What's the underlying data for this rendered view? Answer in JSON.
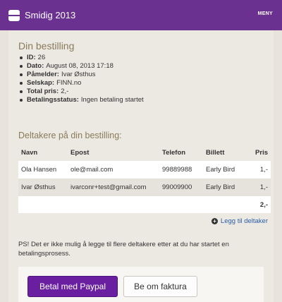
{
  "header": {
    "title": "Smidig 2013",
    "menu_label": "MENY"
  },
  "order": {
    "title": "Din bestilling",
    "details": [
      {
        "label": "ID:",
        "value": "26"
      },
      {
        "label": "Dato:",
        "value": "August 08, 2013 17:18"
      },
      {
        "label": "Påmelder:",
        "value": "Ivar Østhus"
      },
      {
        "label": "Selskap:",
        "value": "FINN.no"
      },
      {
        "label": "Total pris:",
        "value": "2,-"
      },
      {
        "label": "Betalingsstatus:",
        "value": "Ingen betaling startet"
      }
    ]
  },
  "participants": {
    "title": "Deltakere på din bestilling:",
    "columns": [
      "Navn",
      "Epost",
      "Telefon",
      "Billett",
      "Pris"
    ],
    "rows": [
      {
        "name": "Ola Hansen",
        "email": "ole@mail.com",
        "phone": "99889988",
        "ticket": "Early Bird",
        "price": "1,-"
      },
      {
        "name": "Ivar Østhus",
        "email": "ivarconr+test@gmail.com",
        "phone": "99009900",
        "ticket": "Early Bird",
        "price": "1,-"
      }
    ],
    "total": "2,-",
    "add_label": "Legg til deltaker"
  },
  "note": "PS! Det er ikke mulig å legge til flere deltakere etter at du har startet en betalingsprosess.",
  "actions": {
    "paypal_label": "Betal med Paypal",
    "invoice_label": "Be om faktura"
  },
  "colors": {
    "header_bg": "#6a3190",
    "primary_button": "#6a1fa0",
    "heading": "#8a7a5a",
    "link": "#2b5da8"
  }
}
